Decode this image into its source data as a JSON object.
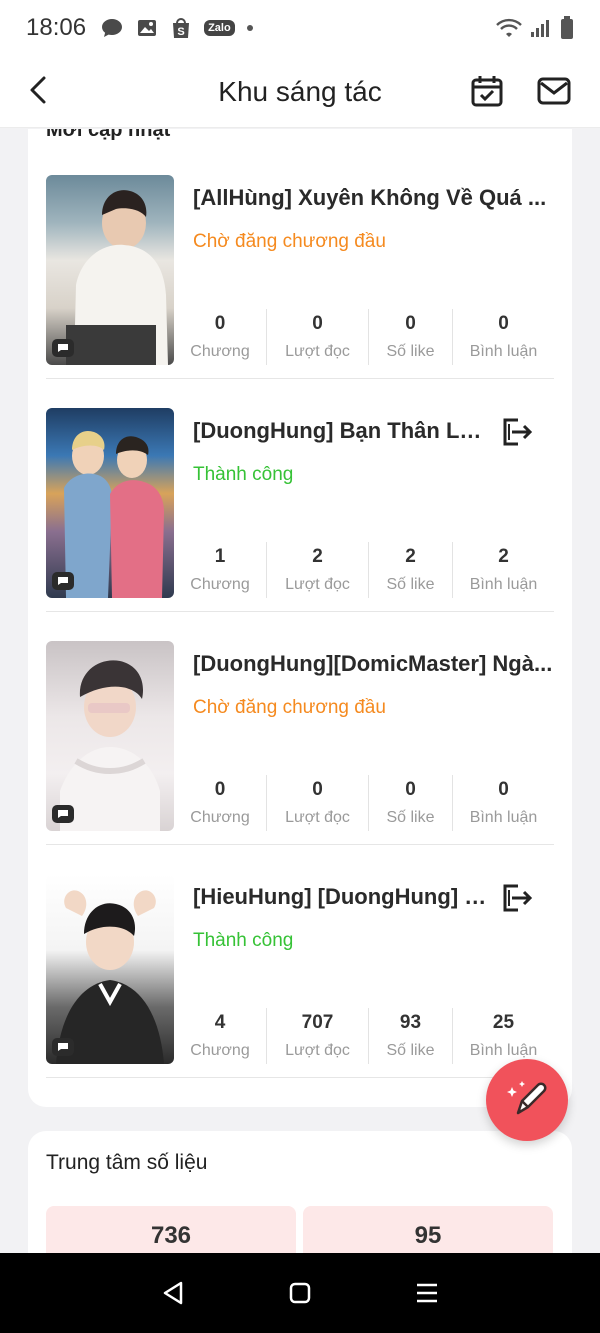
{
  "status_bar": {
    "time": "18:06",
    "notification_icons": [
      "message-icon",
      "gallery-icon",
      "shopee-icon",
      "zalo-icon"
    ],
    "zalo_label": "Zalo",
    "system_icons": [
      "wifi-icon",
      "signal-icon",
      "battery-icon"
    ]
  },
  "header": {
    "title": "Khu sáng tác",
    "back_icon": "chevron-left-icon",
    "calendar_icon": "calendar-check-icon",
    "mail_icon": "mail-icon"
  },
  "works": [
    {
      "title": "[AllHùng] Xuyên Không Về Quá ...",
      "status": "Chờ đăng chương đầu",
      "status_type": "pending",
      "has_export": false,
      "stats": [
        {
          "value": "0",
          "label": "Chương"
        },
        {
          "value": "0",
          "label": "Lượt đọc"
        },
        {
          "value": "0",
          "label": "Số like"
        },
        {
          "value": "0",
          "label": "Bình luận"
        }
      ]
    },
    {
      "title": "[DuongHung] Bạn Thân Là ...",
      "status": "Thành công",
      "status_type": "success",
      "has_export": true,
      "stats": [
        {
          "value": "1",
          "label": "Chương"
        },
        {
          "value": "2",
          "label": "Lượt đọc"
        },
        {
          "value": "2",
          "label": "Số like"
        },
        {
          "value": "2",
          "label": "Bình luận"
        }
      ]
    },
    {
      "title": "[DuongHung][DomicMaster] Ngà...",
      "status": "Chờ đăng chương đầu",
      "status_type": "pending",
      "has_export": false,
      "stats": [
        {
          "value": "0",
          "label": "Chương"
        },
        {
          "value": "0",
          "label": "Lượt đọc"
        },
        {
          "value": "0",
          "label": "Số like"
        },
        {
          "value": "0",
          "label": "Bình luận"
        }
      ]
    },
    {
      "title": "[HieuHung] [DuongHung] [S...",
      "status": "Thành công",
      "status_type": "success",
      "has_export": true,
      "stats": [
        {
          "value": "4",
          "label": "Chương"
        },
        {
          "value": "707",
          "label": "Lượt đọc"
        },
        {
          "value": "93",
          "label": "Số like"
        },
        {
          "value": "25",
          "label": "Bình luận"
        }
      ]
    }
  ],
  "stats_center": {
    "title": "Trung tâm số liệu",
    "metrics": [
      "736",
      "95"
    ]
  },
  "fab_icon": "pencil-sparkle-icon",
  "nav_bar": [
    "back-triangle-icon",
    "home-square-icon",
    "menu-lines-icon"
  ],
  "colors": {
    "pending": "#f58a1f",
    "success": "#36c236",
    "fab": "#f1525b",
    "metric_bg": "#fde8e8"
  }
}
